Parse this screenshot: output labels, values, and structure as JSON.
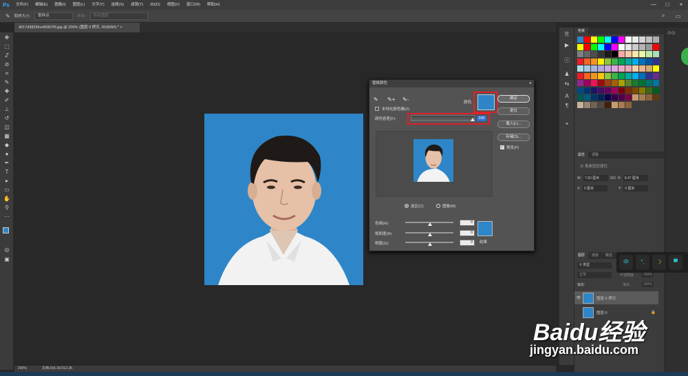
{
  "app": {
    "logo": "Ps"
  },
  "menu": [
    "文件(F)",
    "编辑(E)",
    "图像(I)",
    "图层(L)",
    "文字(Y)",
    "选择(S)",
    "滤镜(T)",
    "3D(D)",
    "视图(V)",
    "窗口(W)",
    "帮助(H)"
  ],
  "window_controls": {
    "minimize": "—",
    "maximize": "□",
    "close": "×"
  },
  "options": {
    "sample_size_label": "取样大小:",
    "sample_size_value": "取样点",
    "sample_label": "样本:",
    "sample_value": "所有图层"
  },
  "document": {
    "tab_title": "d017d3825fce45907f6.jpg @ 200% (图层 0 拷贝, RGB/8#) *",
    "zoom": "200%",
    "doc_size": "文档:156.1K/312.2K"
  },
  "dialog": {
    "title": "替换颜色",
    "close": "×",
    "localized_label": "本地化颜色簇(Z)",
    "color_label": "颜色:",
    "tolerance_label": "颜色容差(F):",
    "tolerance_value": "200",
    "tolerance_fraction": 1.0,
    "selection_label": "选区(C)",
    "image_label": "图像(M)",
    "buttons": {
      "ok": "确定",
      "reset": "复位",
      "load": "载入(L)...",
      "save": "存储(S)..."
    },
    "preview_label": "预览(P)",
    "hue_label": "色相(H):",
    "hue_value": "0",
    "sat_label": "饱和度(A):",
    "sat_value": "0",
    "light_label": "明度(G):",
    "light_value": "0",
    "result_label": "结果",
    "target_color": "#2e86c8"
  },
  "panels": {
    "swatches_tab": "色板",
    "properties_tab": "属性",
    "adjust_tab": "调整",
    "pixel_layer": "像素图层属性",
    "w_label": "W:",
    "w_value": "7.83 厘米",
    "h_label": "H:",
    "h_value": "8.47 厘米",
    "x_label": "X:",
    "x_value": "0 厘米",
    "y_label": "Y:",
    "y_value": "0 厘米",
    "go_symbol": "GO",
    "layers_tab": "图层",
    "channels_tab": "通道",
    "paths_tab": "路径",
    "kind": "类型",
    "normal_label": "正常",
    "opacity": "不透明度:",
    "opacity_value": "100%",
    "lock_label": "锁定:",
    "fill_label": "填充:",
    "fill_value": "100%",
    "layers": [
      "图层 0 拷贝",
      "图层 0"
    ]
  },
  "float_toolbar": [
    "中",
    "°,",
    "☽",
    "▀"
  ],
  "watermark": {
    "logo": "Baidu经验",
    "url": "jingyan.baidu.com"
  }
}
